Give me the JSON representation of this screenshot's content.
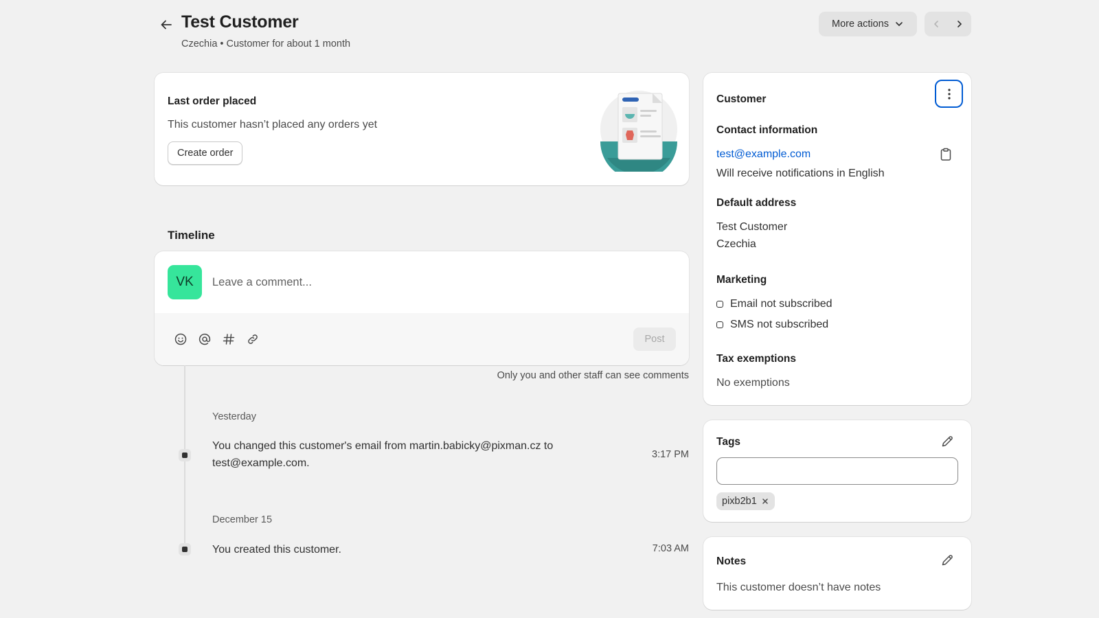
{
  "header": {
    "title": "Test Customer",
    "subtitle": "Czechia • Customer for about 1 month",
    "more_actions_label": "More actions"
  },
  "last_order": {
    "title": "Last order placed",
    "message": "This customer hasn’t placed any orders yet",
    "create_order_label": "Create order"
  },
  "timeline": {
    "heading": "Timeline",
    "avatar_initials": "VK",
    "comment_placeholder": "Leave a comment...",
    "post_label": "Post",
    "visibility_note": "Only you and other staff can see comments",
    "groups": [
      {
        "date": "Yesterday",
        "events": [
          {
            "text_line1": "You changed this customer's email from martin.babicky@pixman.cz to",
            "text_line2": "test@example.com.",
            "time": "3:17 PM"
          }
        ]
      },
      {
        "date": "December 15",
        "events": [
          {
            "text_line1": "You created this customer.",
            "text_line2": "",
            "time": "7:03 AM"
          }
        ]
      }
    ]
  },
  "customer": {
    "title": "Customer",
    "contact_heading": "Contact information",
    "email": "test@example.com",
    "notification_language": "Will receive notifications in English",
    "address_heading": "Default address",
    "address_name": "Test Customer",
    "address_country": "Czechia",
    "marketing_heading": "Marketing",
    "marketing_email": "Email not subscribed",
    "marketing_sms": "SMS not subscribed",
    "tax_heading": "Tax exemptions",
    "tax_value": "No exemptions"
  },
  "tags": {
    "title": "Tags",
    "input_value": "",
    "items": [
      "pixb2b1"
    ]
  },
  "notes": {
    "title": "Notes",
    "message": "This customer doesn’t have notes"
  },
  "colors": {
    "accent": "#005bd3",
    "avatar_bg": "#36e59b",
    "page_bg": "#f1f1f1"
  }
}
